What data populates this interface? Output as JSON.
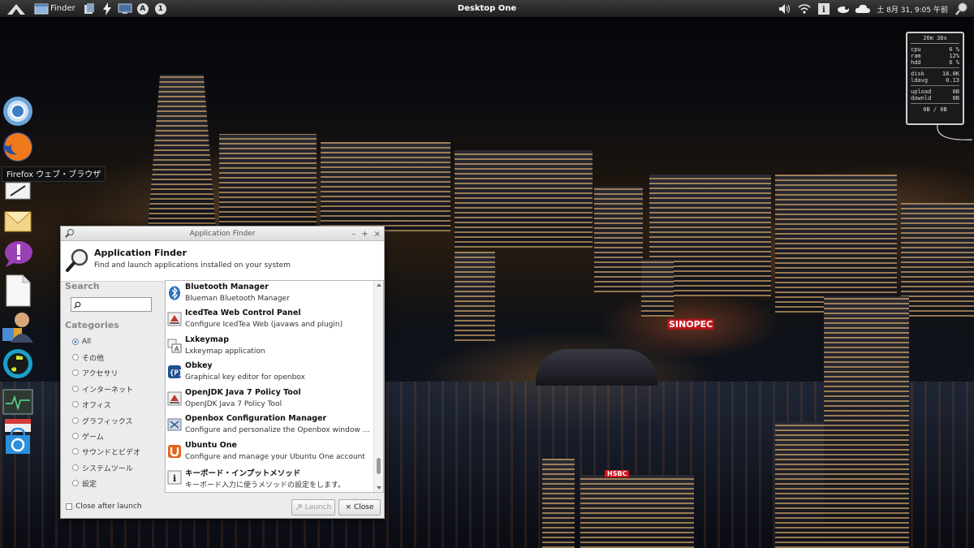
{
  "top_panel": {
    "finder_label": "Finder",
    "title": "Desktop One",
    "clock": "土 8月 31, 9:05 午前",
    "badge_a": "A",
    "badge_1": "1"
  },
  "dock": {
    "tooltip": "Firefox ウェブ・ブラウザ",
    "items": [
      "chromium-icon",
      "firefox-icon",
      "text-editor-icon",
      "mail-icon",
      "notification-icon",
      "document-icon",
      "user-accounts-icon",
      "music-player-icon",
      "system-monitor-icon",
      "calendar-icon",
      "app-store-icon"
    ]
  },
  "monitor": {
    "uptime": "26m 38s",
    "cpu_label": "cpu",
    "cpu": "6 %",
    "ram_label": "ram",
    "ram": "12%",
    "hdd_label": "hdd",
    "hdd": "6 %",
    "disk_label": "disk",
    "disk": "18.0K",
    "ldavg_label": "ldavg",
    "ldavg": "0.13",
    "upload_label": "upload",
    "upload": "0B",
    "download_label": "downld",
    "download": "0B",
    "totals": "0B   / 0B"
  },
  "wallpaper": {
    "sign_sinopec": "SINOPEC",
    "sign_hsbc": "HSBC"
  },
  "appfinder": {
    "window_title": "Application Finder",
    "header_title": "Application Finder",
    "header_subtitle": "Find and launch applications installed on your system",
    "search_label": "Search",
    "search_value": "",
    "categories_label": "Categories",
    "categories": [
      {
        "label": "All",
        "selected": true
      },
      {
        "label": "その他",
        "selected": false
      },
      {
        "label": "アクセサリ",
        "selected": false
      },
      {
        "label": "インターネット",
        "selected": false
      },
      {
        "label": "オフィス",
        "selected": false
      },
      {
        "label": "グラフィックス",
        "selected": false
      },
      {
        "label": "ゲーム",
        "selected": false
      },
      {
        "label": "サウンドとビデオ",
        "selected": false
      },
      {
        "label": "システムツール",
        "selected": false
      },
      {
        "label": "設定",
        "selected": false
      }
    ],
    "apps": [
      {
        "name": "Bluetooth Manager",
        "desc": "Blueman Bluetooth Manager",
        "icon": "bluetooth-icon"
      },
      {
        "name": "IcedTea Web Control Panel",
        "desc": "Configure IcedTea Web (javaws and plugin)",
        "icon": "java-icon"
      },
      {
        "name": "Lxkeymap",
        "desc": "Lxkeymap application",
        "icon": "keymap-icon"
      },
      {
        "name": "Obkey",
        "desc": "Graphical key editor for openbox",
        "icon": "obkey-icon"
      },
      {
        "name": "OpenJDK Java 7 Policy Tool",
        "desc": "OpenJDK Java 7 Policy Tool",
        "icon": "java-policy-icon"
      },
      {
        "name": "Openbox Configuration Manager",
        "desc": "Configure and personalize the Openbox window …",
        "icon": "openbox-config-icon"
      },
      {
        "name": "Ubuntu One",
        "desc": "Configure and manage your Ubuntu One account",
        "icon": "ubuntu-one-icon"
      },
      {
        "name": "キーボード・インプットメソッド",
        "desc": "キーボード入力に使うメソッドの設定をします。",
        "icon": "info-icon"
      }
    ],
    "close_after_launch": "Close after launch",
    "launch_label": "Launch",
    "close_label": "Close"
  },
  "colors": {
    "panel": "#2b2b2b",
    "window_bg": "#ececec",
    "radio_on": "#6a8ab5"
  }
}
